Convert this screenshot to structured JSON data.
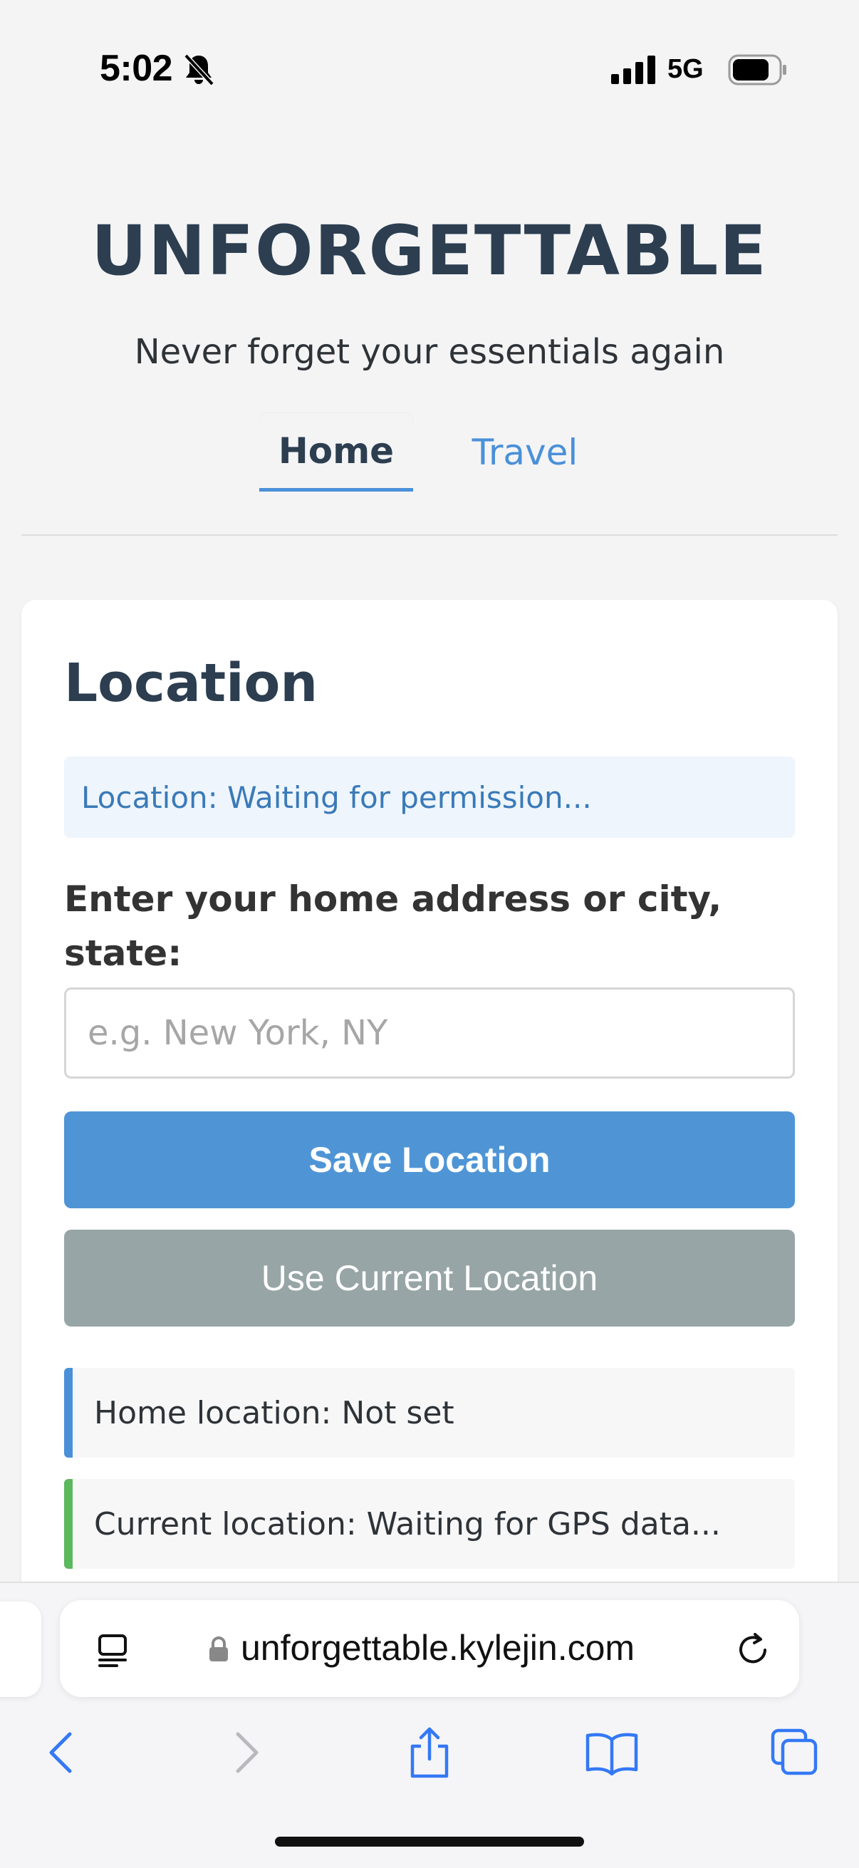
{
  "status_bar": {
    "time": "5:02",
    "network": "5G",
    "icons": [
      "bell-slash-icon",
      "signal-icon",
      "battery-icon"
    ]
  },
  "header": {
    "title": "UNFORGETTABLE",
    "tagline": "Never forget your essentials again"
  },
  "tabs": [
    {
      "label": "Home",
      "active": true
    },
    {
      "label": "Travel",
      "active": false
    }
  ],
  "location_card": {
    "title": "Location",
    "status_message": "Location: Waiting for permission...",
    "address_label": "Enter your home address or city, state:",
    "address_input": {
      "value": "",
      "placeholder": "e.g. New York, NY"
    },
    "save_button": "Save Location",
    "current_location_button": "Use Current Location",
    "home_location_text": "Home location: Not set",
    "current_location_text": "Current location: Waiting for GPS data..."
  },
  "browser": {
    "url": "unforgettable.kylejin.com",
    "toolbar_icons": [
      "back-icon",
      "forward-icon",
      "share-icon",
      "bookmarks-icon",
      "tabs-icon"
    ]
  },
  "colors": {
    "accent": "#4f95d6",
    "secondary_button": "#97a5a6",
    "title": "#2c3e50",
    "home_bar": "#4a90d9",
    "current_bar": "#5cb85c",
    "ios_blue": "#3478f6"
  }
}
